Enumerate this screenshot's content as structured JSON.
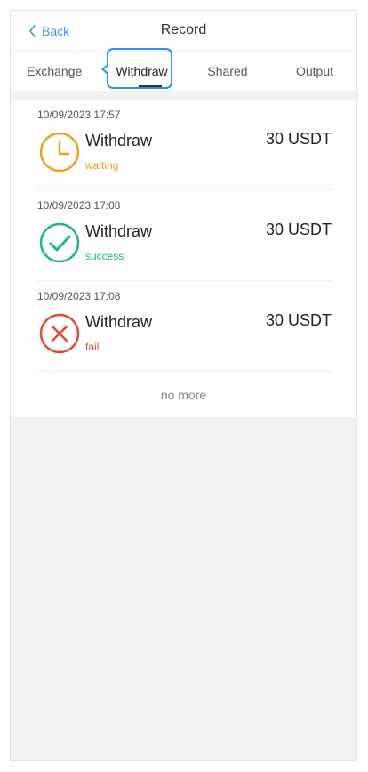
{
  "navbar": {
    "back_label": "Back",
    "title": "Record",
    "back_icon": "chevron-left-icon"
  },
  "tabs": [
    {
      "label": "Exchange",
      "active": false
    },
    {
      "label": "Withdraw",
      "active": true
    },
    {
      "label": "Shared",
      "active": false
    },
    {
      "label": "Output",
      "active": false
    }
  ],
  "records": [
    {
      "date": "10/09/2023 17:57",
      "type": "Withdraw",
      "status": "waiting",
      "amount": "30 USDT",
      "icon": "clock-icon",
      "color": "#f0a020"
    },
    {
      "date": "10/09/2023 17:08",
      "type": "Withdraw",
      "status": "success",
      "amount": "30 USDT",
      "icon": "check-circle-icon",
      "color": "#1db58f"
    },
    {
      "date": "10/09/2023 17:08",
      "type": "Withdraw",
      "status": "fail",
      "amount": "30 USDT",
      "icon": "x-circle-icon",
      "color": "#e04a3c"
    }
  ],
  "list_footer": "no more",
  "colors": {
    "accent": "#4a90e2",
    "highlight": "#2f8ef0",
    "background": "#f2f2f2"
  }
}
